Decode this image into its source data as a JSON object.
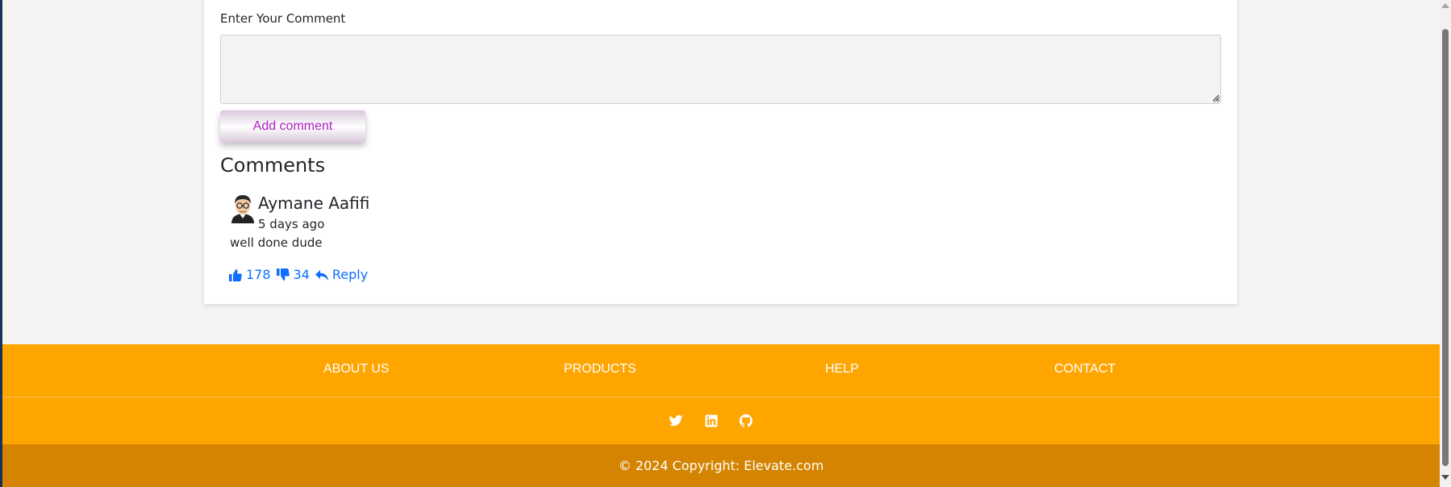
{
  "comment_form": {
    "label": "Enter Your Comment",
    "textarea_value": "",
    "textarea_placeholder": "",
    "submit_label": "Add comment"
  },
  "comments": {
    "title": "Comments",
    "items": [
      {
        "author": "Aymane Aafifi",
        "time": "5 days ago",
        "text": "well done dude",
        "likes": "178",
        "dislikes": "34",
        "reply_label": "Reply"
      }
    ]
  },
  "footer": {
    "nav": [
      "ABOUT US",
      "PRODUCTS",
      "HELP",
      "CONTACT"
    ],
    "social_icons": [
      "twitter-icon",
      "linkedin-icon",
      "github-icon"
    ],
    "copyright": "© 2024 Copyright: Elevate.com"
  },
  "colors": {
    "footer_bg": "#ffa500",
    "copyright_bg": "#d48400",
    "action_blue": "#0d6efd",
    "button_text": "#b020c0"
  }
}
